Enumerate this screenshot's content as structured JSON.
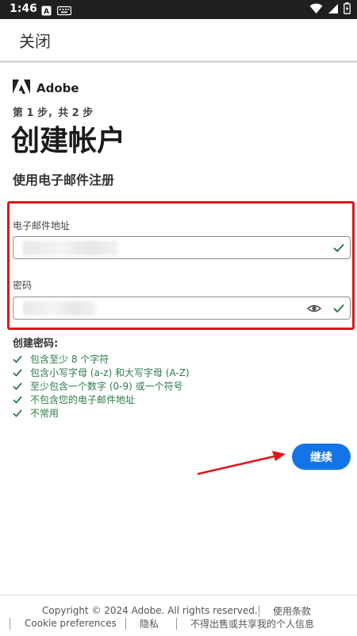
{
  "status_bar": {
    "time": "1:46"
  },
  "top_bar": {
    "close_label": "关闭"
  },
  "brand": {
    "name": "Adobe"
  },
  "step_text": "第 1 步，共 2 步",
  "page_title": "创建帐户",
  "subtitle": "使用电子邮件注册",
  "form": {
    "email_label": "电子邮件地址",
    "password_label": "密码"
  },
  "password_rules": {
    "title": "创建密码:",
    "items": [
      "包含至少 8 个字符",
      "包含小写字母 (a-z) 和大写字母 (A-Z)",
      "至少包含一个数字 (0-9) 或一个符号",
      "不包含您的电子邮件地址",
      "不常用"
    ]
  },
  "continue_label": "继续",
  "footer": {
    "copyright": "Copyright © 2024 Adobe. All rights reserved.",
    "terms": "使用条款",
    "cookie": "Cookie preferences",
    "privacy": "隐私",
    "no_sell": "不得出售或共享我的个人信息"
  },
  "colors": {
    "accent": "#1473e6",
    "success": "#2d7a4a",
    "annotation": "#e2141b",
    "status_bar": "#1f1f1f"
  },
  "icons": [
    "notification-a-icon",
    "keyboard-icon",
    "wifi-icon",
    "signal-icon",
    "battery-icon",
    "adobe-logo-icon",
    "check-icon",
    "eye-icon"
  ]
}
